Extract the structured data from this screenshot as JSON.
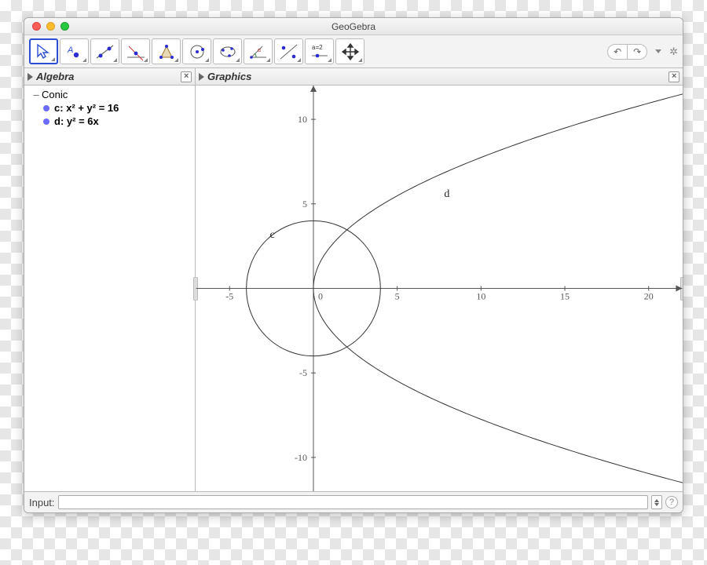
{
  "window": {
    "title": "GeoGebra"
  },
  "panels": {
    "algebra": "Algebra",
    "graphics": "Graphics"
  },
  "toolbar_icons": [
    "move",
    "point",
    "line",
    "perpendicular",
    "polygon",
    "circle",
    "conic",
    "angle",
    "reflect",
    "slider",
    "movegraphics"
  ],
  "algebra": {
    "group": "Conic",
    "items": [
      {
        "label": "c",
        "expr": "x² + y² = 16"
      },
      {
        "label": "d",
        "expr": "y² = 6x"
      }
    ]
  },
  "input": {
    "label": "Input:",
    "value": ""
  },
  "chart_data": {
    "type": "line",
    "title": "",
    "xlabel": "",
    "ylabel": "",
    "xlim": [
      -7,
      22
    ],
    "ylim": [
      -12,
      12
    ],
    "x_ticks": [
      -5,
      0,
      5,
      10,
      15,
      20
    ],
    "y_ticks": [
      -10,
      -5,
      0,
      5,
      10
    ],
    "objects": [
      {
        "name": "c",
        "type": "circle",
        "equation": "x^2 + y^2 = 16",
        "center": [
          0,
          0
        ],
        "radius": 4
      },
      {
        "name": "d",
        "type": "parabola",
        "equation": "y^2 = 6x",
        "vertex": [
          0,
          0
        ],
        "axis": "x",
        "p": 6
      }
    ],
    "labels": [
      {
        "for": "c",
        "text": "c",
        "at": [
          -2.6,
          3.0
        ]
      },
      {
        "for": "d",
        "text": "d",
        "at": [
          7.8,
          5.4
        ]
      }
    ]
  }
}
